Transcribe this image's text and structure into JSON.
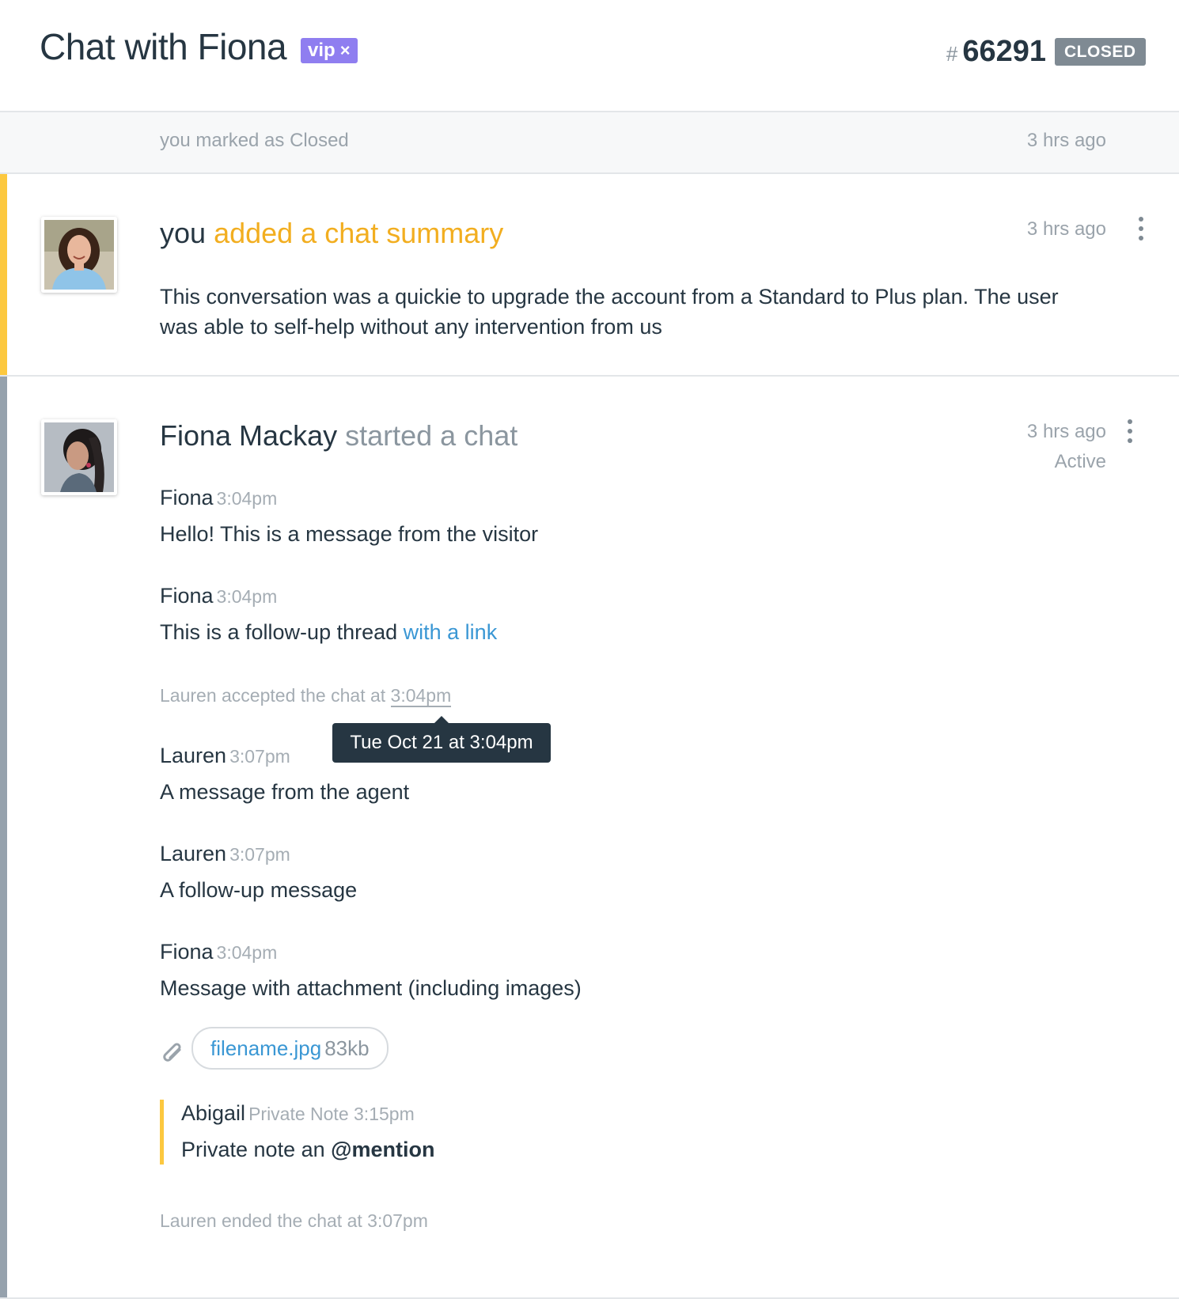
{
  "header": {
    "title": "Chat with Fiona",
    "tag": "vip",
    "tag_remove": "×",
    "ticket_hash": "#",
    "ticket_number": "66291",
    "status": "CLOSED"
  },
  "status_event": {
    "text": "you marked as Closed",
    "time": "3 hrs ago"
  },
  "summary": {
    "actor": "you",
    "action": "added a chat summary",
    "time": "3 hrs ago",
    "body": "This conversation was a quickie to upgrade the account from a Standard to Plus plan. The user was able to self-help without any intervention from us"
  },
  "chat": {
    "actor": "Fiona Mackay",
    "action": "started a chat",
    "time": "3 hrs ago",
    "state": "Active",
    "messages": [
      {
        "author": "Fiona",
        "time": "3:04pm",
        "text": "Hello! This is a message from the visitor"
      },
      {
        "author": "Fiona",
        "time": "3:04pm",
        "text": "This is a follow-up thread ",
        "link": "with a link"
      },
      {
        "author": "Lauren",
        "time": "3:07pm",
        "text": "A message from the agent"
      },
      {
        "author": "Lauren",
        "time": "3:07pm",
        "text": "A follow-up message"
      },
      {
        "author": "Fiona",
        "time": "3:04pm",
        "text": "Message with attachment (including images)"
      }
    ],
    "accepted_text": "Lauren accepted the chat at ",
    "accepted_time": "3:04pm",
    "tooltip": "Tue Oct 21 at 3:04pm",
    "attachment": {
      "name": "filename.jpg",
      "size": "83kb"
    },
    "note": {
      "author": "Abigail",
      "meta": "Private Note 3:15pm",
      "text": "Private note an ",
      "mention": "@mention"
    },
    "ended_text": "Lauren ended the chat at 3:07pm"
  },
  "colors": {
    "accent_yellow": "#fcc83f",
    "summary_orange": "#f2ae20",
    "link_blue": "#3a97d4",
    "vip_purple": "#8f7ef0",
    "closed_gray": "#7f8a93"
  }
}
